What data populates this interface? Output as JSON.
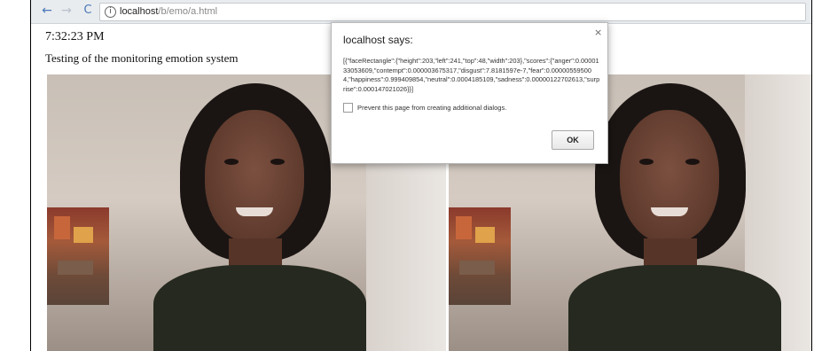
{
  "browser": {
    "url_host": "localhost",
    "url_path": "/b/emo/a.html",
    "back_icon": "←",
    "forward_icon": "→",
    "reload_icon": "C",
    "info_icon": "i"
  },
  "page": {
    "clock": "7:32:23 PM",
    "subtitle": "Testing of the monitoring emotion system"
  },
  "dialog": {
    "title": "localhost says:",
    "close": "×",
    "message": "[{\"faceRectangle\":{\"height\":203,\"left\":241,\"top\":48,\"width\":203},\"scores\":{\"anger\":0.0000133053609,\"contempt\":0.000003675317,\"disgust\":7.8181597e-7,\"fear\":0.000005595004,\"happiness\":0.999409854,\"neutral\":0.0004185109,\"sadness\":0.00000122702613,\"surprise\":0.000147021026}}]",
    "checkbox_label": "Prevent this page from creating additional dialogs.",
    "ok_label": "OK"
  },
  "colors": {
    "accent": "#4a78b8",
    "chrome": "#e9ecef"
  }
}
